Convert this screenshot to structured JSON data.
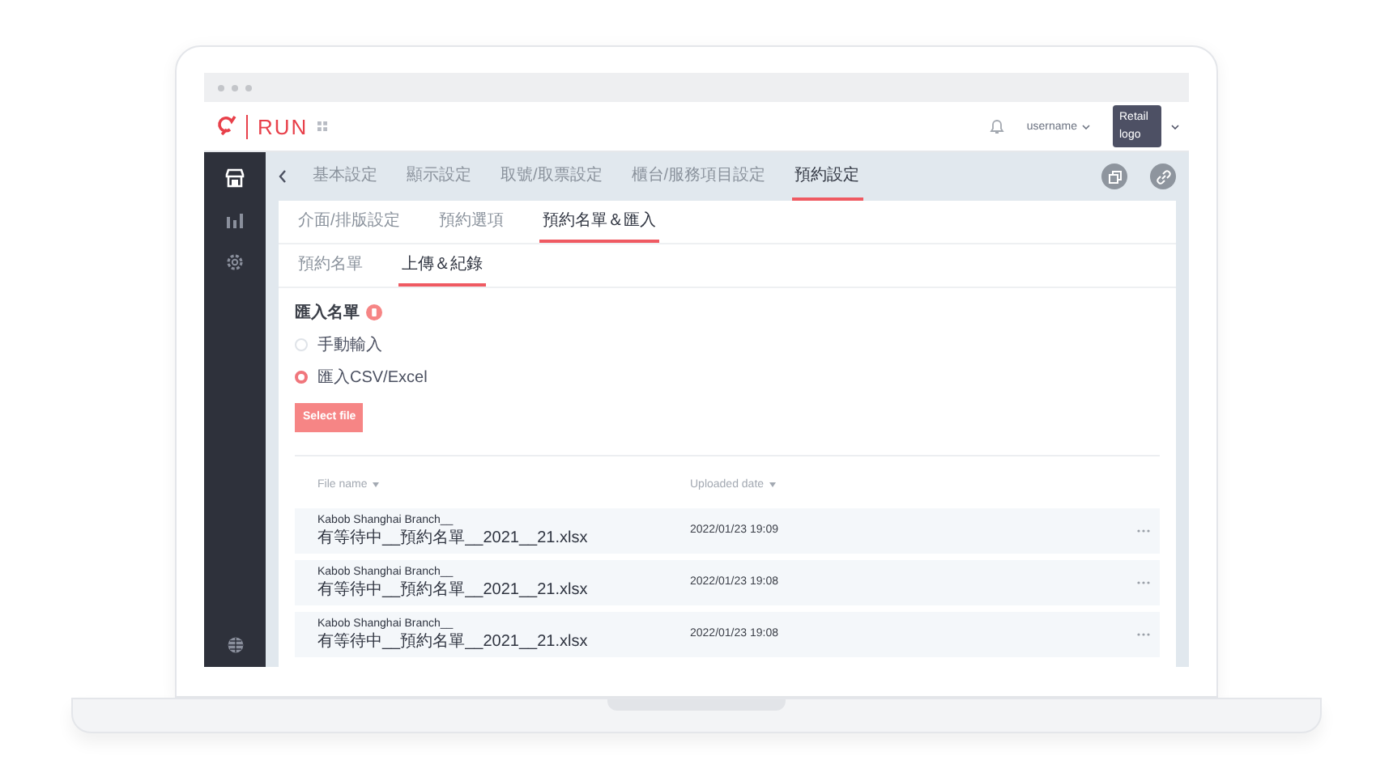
{
  "header": {
    "app_name": "RUN",
    "username": "username",
    "retail_logo": "Retail logo"
  },
  "sidebar": {
    "items": [
      {
        "kind": "store",
        "selected": true
      },
      {
        "kind": "chart",
        "selected": false
      },
      {
        "kind": "settings",
        "selected": false
      }
    ]
  },
  "tabs": [
    {
      "label": "基本設定",
      "selected": false
    },
    {
      "label": "顯示設定",
      "selected": false
    },
    {
      "label": "取號/取票設定",
      "selected": false
    },
    {
      "label": "櫃台/服務項目設定",
      "selected": false
    },
    {
      "label": "預約設定",
      "selected": true
    }
  ],
  "sub_tabs": [
    {
      "label": "介面/排版設定",
      "selected": false
    },
    {
      "label": "預約選項",
      "selected": false
    },
    {
      "label": "預約名單＆匯入",
      "selected": true
    }
  ],
  "section_tabs": [
    {
      "label": "預約名單",
      "selected": false
    },
    {
      "label": "上傳＆紀錄",
      "selected": true
    }
  ],
  "import_section": {
    "title": "匯入名單",
    "options": [
      {
        "label": "手動輸入",
        "selected": false
      },
      {
        "label": "匯入CSV/Excel",
        "selected": true
      }
    ],
    "button": "Select file"
  },
  "table": {
    "columns": [
      {
        "label": "File name"
      },
      {
        "label": "Uploaded date"
      }
    ],
    "rows": [
      {
        "file_name": [
          "Kabob Shanghai Branch__",
          "有等待中__預約名單__2021__21.xlsx"
        ],
        "uploaded_date": "2022/01/23 19:09"
      },
      {
        "file_name": [
          "Kabob Shanghai Branch__",
          "有等待中__預約名單__2021__21.xlsx"
        ],
        "uploaded_date": "2022/01/23 19:08"
      },
      {
        "file_name": [
          "Kabob Shanghai Branch__",
          "有等待中__預約名單__2021__21.xlsx"
        ],
        "uploaded_date": "2022/01/23 19:08"
      }
    ]
  }
}
